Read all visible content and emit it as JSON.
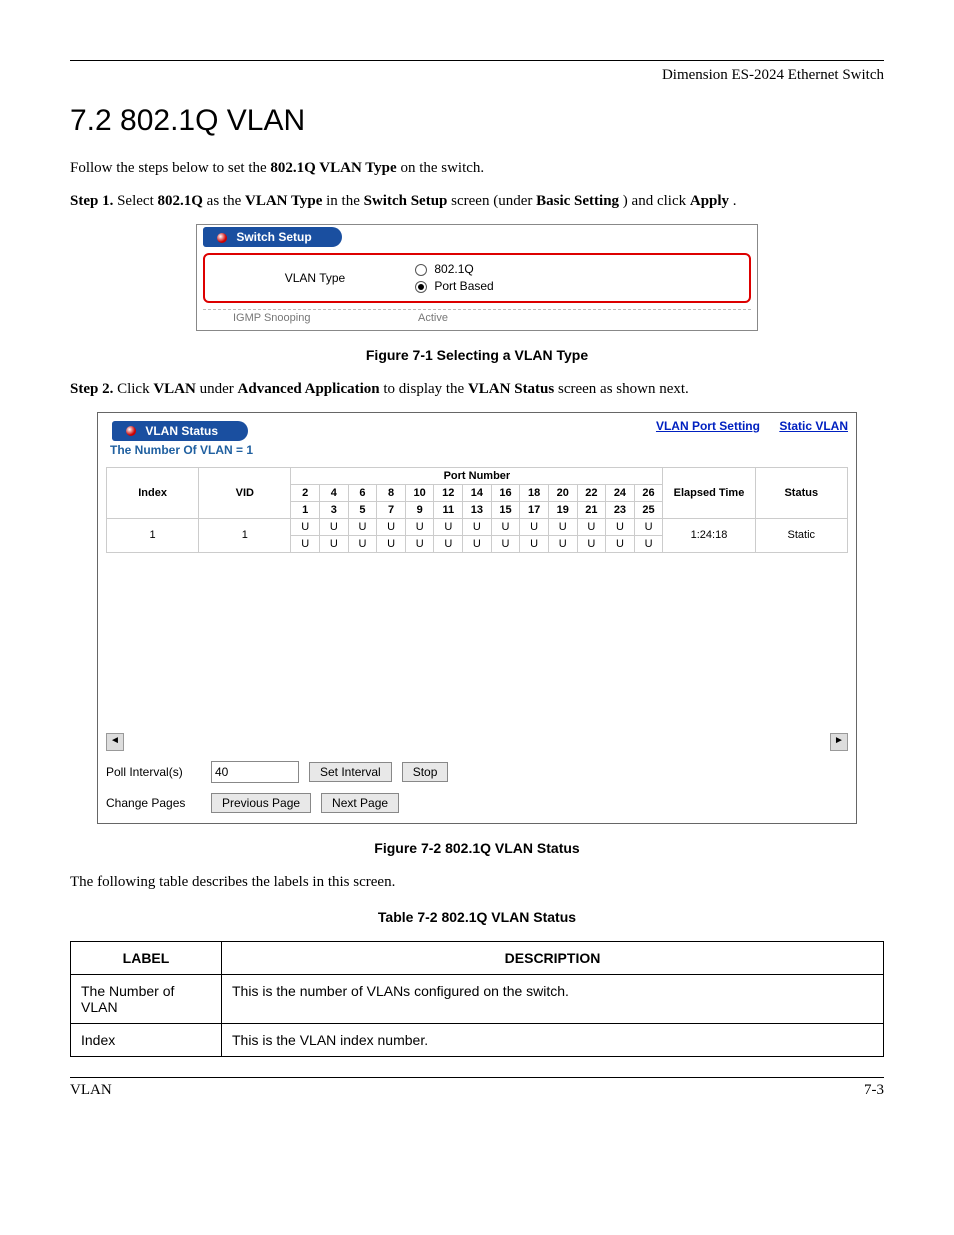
{
  "header": {
    "product": "Dimension ES-2024 Ethernet Switch"
  },
  "section_title": "7.2  802.1Q VLAN",
  "intro": {
    "lead": "Follow the steps below to set the ",
    "bold1": "802.1Q VLAN Type",
    "tail": " on the switch."
  },
  "step1": {
    "label": "Step 1.",
    "t1": " Select ",
    "b1": "802.1Q",
    "t2": " as the ",
    "b2": "VLAN Type",
    "t3": " in the ",
    "b3": "Switch Setup",
    "t4": " screen (under ",
    "b4": "Basic Setting",
    "t5": ") and click ",
    "b5": "Apply",
    "t6": "."
  },
  "fig1": {
    "tab_title": "Switch Setup",
    "row_label": "VLAN Type",
    "radio1": "802.1Q",
    "radio2": "Port Based",
    "gray1": "IGMP Snooping",
    "gray2": "Active"
  },
  "caption1": "Figure 7-1 Selecting a VLAN Type",
  "step2": {
    "label": "Step 2.",
    "t1": " Click ",
    "b1": "VLAN",
    "t2": " under ",
    "b2": "Advanced Application",
    "t3": " to display the ",
    "b3": "VLAN Status",
    "t4": " screen as shown next."
  },
  "fig2": {
    "tab_title": "VLAN Status",
    "count": "The Number Of VLAN = 1",
    "link1": "VLAN Port Setting",
    "link2": "Static VLAN",
    "headers": {
      "index": "Index",
      "vid": "VID",
      "port_number": "Port Number",
      "elapsed": "Elapsed Time",
      "status": "Status"
    },
    "port_cols_top": [
      "2",
      "4",
      "6",
      "8",
      "10",
      "12",
      "14",
      "16",
      "18",
      "20",
      "22",
      "24",
      "26"
    ],
    "port_cols_bot": [
      "1",
      "3",
      "5",
      "7",
      "9",
      "11",
      "13",
      "15",
      "17",
      "19",
      "21",
      "23",
      "25"
    ],
    "row": {
      "index": "1",
      "vid": "1",
      "vals_top": [
        "U",
        "U",
        "U",
        "U",
        "U",
        "U",
        "U",
        "U",
        "U",
        "U",
        "U",
        "U",
        "U"
      ],
      "vals_bot": [
        "U",
        "U",
        "U",
        "U",
        "U",
        "U",
        "U",
        "U",
        "U",
        "U",
        "U",
        "U",
        "U"
      ],
      "elapsed": "1:24:18",
      "status": "Static"
    },
    "poll_label": "Poll Interval(s)",
    "poll_value": "40",
    "btn_set": "Set Interval",
    "btn_stop": "Stop",
    "change_label": "Change Pages",
    "btn_prev": "Previous Page",
    "btn_next": "Next Page"
  },
  "caption2": "Figure 7-2 802.1Q VLAN Status",
  "table_intro": "The following table describes the labels in this screen.",
  "table_caption": "Table 7-2 802.1Q VLAN Status",
  "table": {
    "h1": "LABEL",
    "h2": "DESCRIPTION",
    "rows": [
      {
        "label": "The Number of VLAN",
        "desc": "This is the number of VLANs configured on the switch."
      },
      {
        "label": "Index",
        "desc": "This is the VLAN index number."
      }
    ]
  },
  "footer": {
    "left": "VLAN",
    "right": "7-3"
  },
  "chart_data": {
    "type": "table",
    "title": "802.1Q VLAN Status",
    "columns": [
      "Index",
      "VID",
      "Port 1..26 membership",
      "Elapsed Time",
      "Status"
    ],
    "rows": [
      {
        "Index": 1,
        "VID": 1,
        "Ports": "U (untagged) on ports 1-26",
        "Elapsed Time": "1:24:18",
        "Status": "Static"
      }
    ]
  }
}
